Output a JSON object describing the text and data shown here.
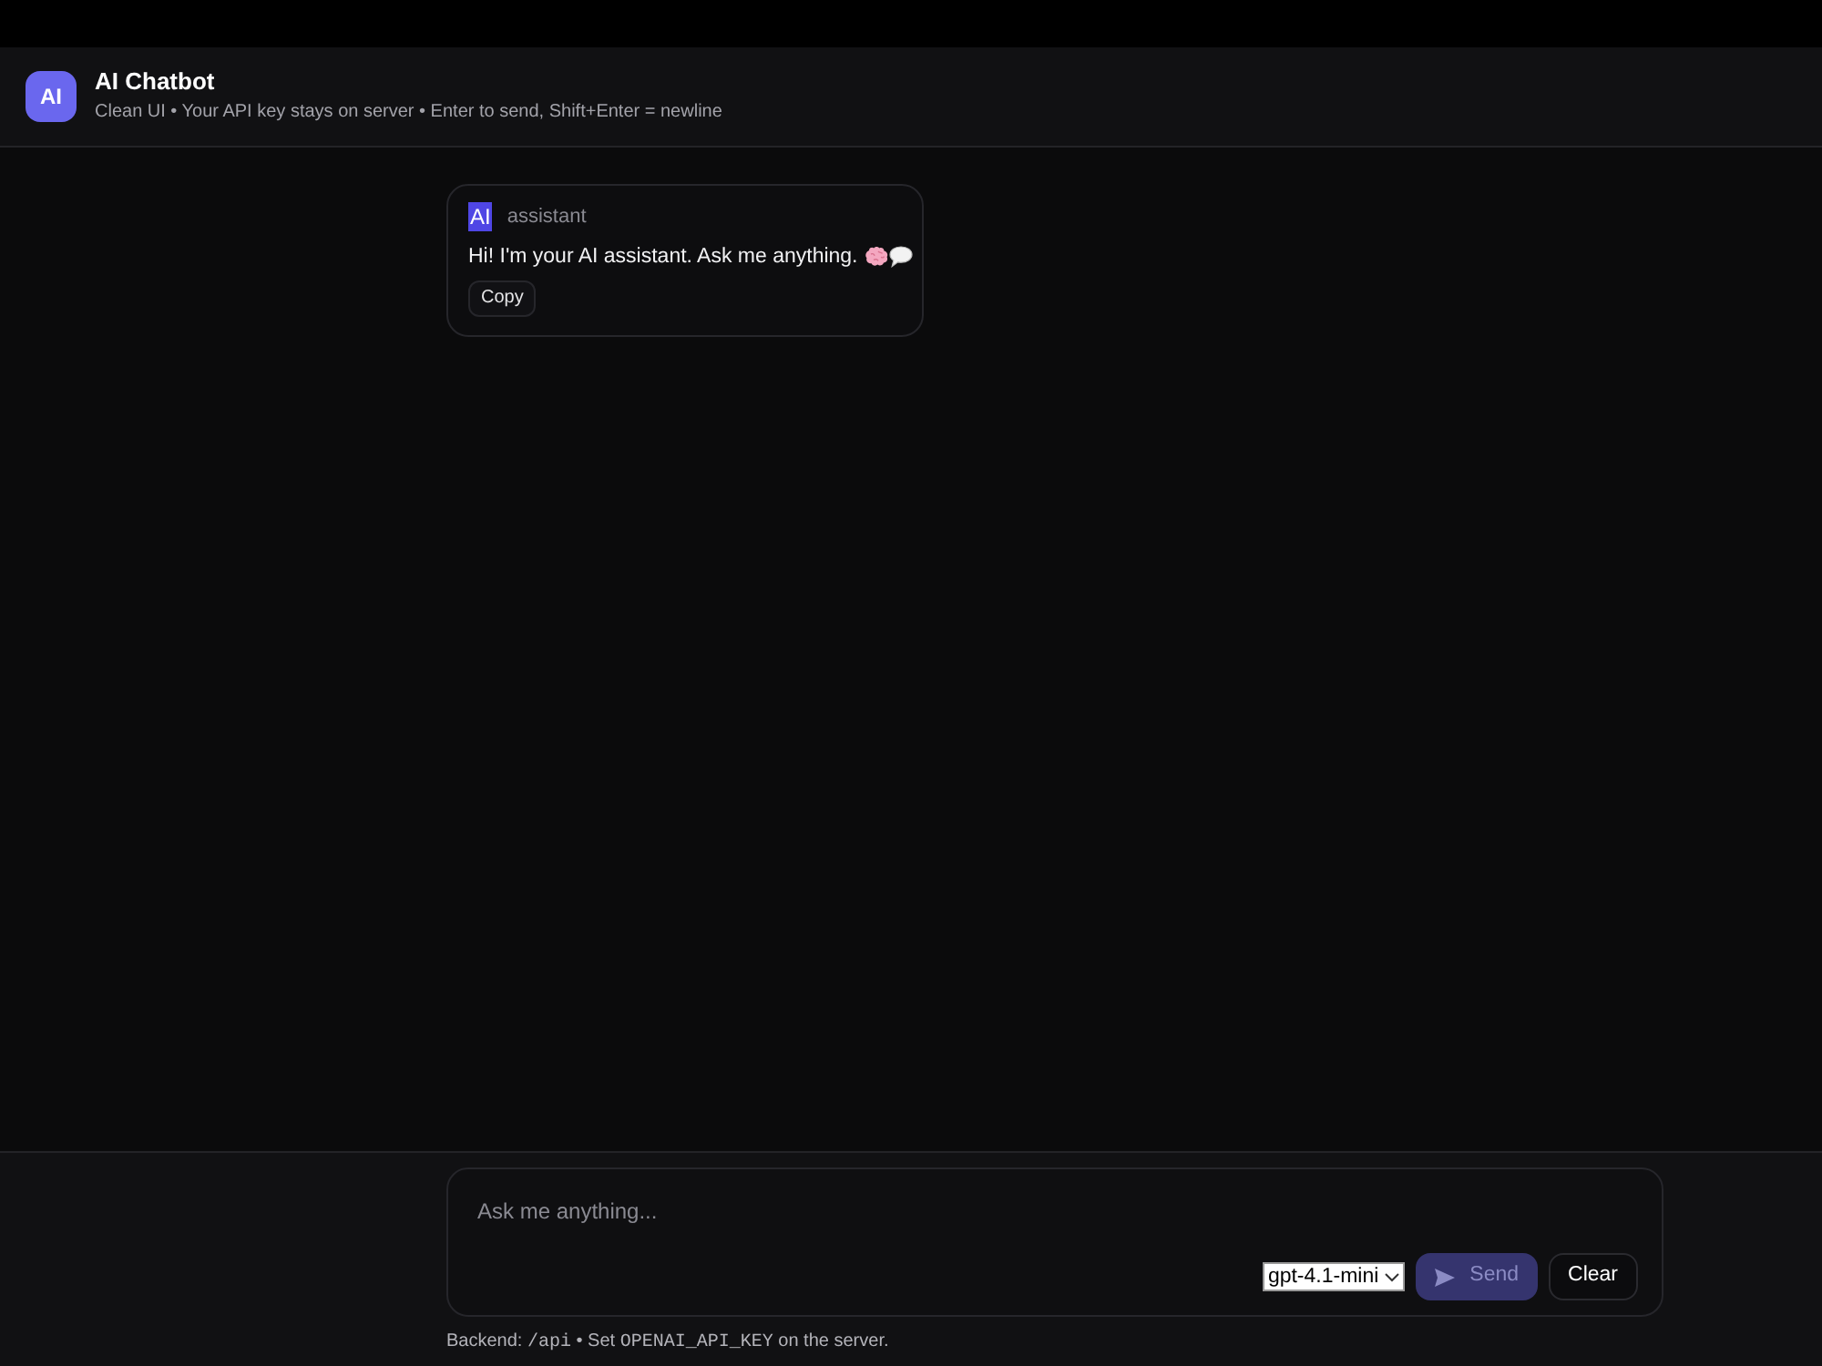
{
  "header": {
    "logo": "AI",
    "title": "AI Chatbot",
    "subtitle": "Clean UI • Your API key stays on server • Enter to send, Shift+Enter = newline"
  },
  "messages": [
    {
      "kind": "assistant",
      "avatar": "AI",
      "role": "assistant",
      "text": "Hi! I'm your AI assistant. Ask me anything.",
      "actions": [
        "Copy"
      ]
    }
  ],
  "composer": {
    "placeholder": "Ask me anything...",
    "model": "gpt-4.1-mini",
    "send": {
      "label": "Send",
      "disabled": true
    },
    "clear": {
      "label": "Clear"
    }
  },
  "footer_note": [
    {
      "kind": "text",
      "text": "Backend: "
    },
    {
      "kind": "code",
      "text": "/api"
    },
    {
      "kind": "text",
      "text": " • Set "
    },
    {
      "kind": "code",
      "text": "OPENAI_API_KEY"
    },
    {
      "kind": "text",
      "text": " on the server."
    }
  ]
}
